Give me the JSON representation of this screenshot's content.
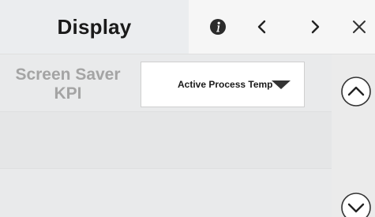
{
  "header": {
    "title": "Display",
    "icons": {
      "info": "info-icon",
      "prev": "chevron-left-icon",
      "next": "chevron-right-icon",
      "close": "close-icon"
    }
  },
  "settings": {
    "rows": [
      {
        "label": "Screen Saver KPI",
        "label_line1": "Screen Saver",
        "label_line2": "KPI",
        "value": "Active Process Temp"
      }
    ]
  },
  "scrollbar": {
    "up_icon": "chevron-up-circle-icon",
    "down_icon": "chevron-down-circle-icon"
  }
}
